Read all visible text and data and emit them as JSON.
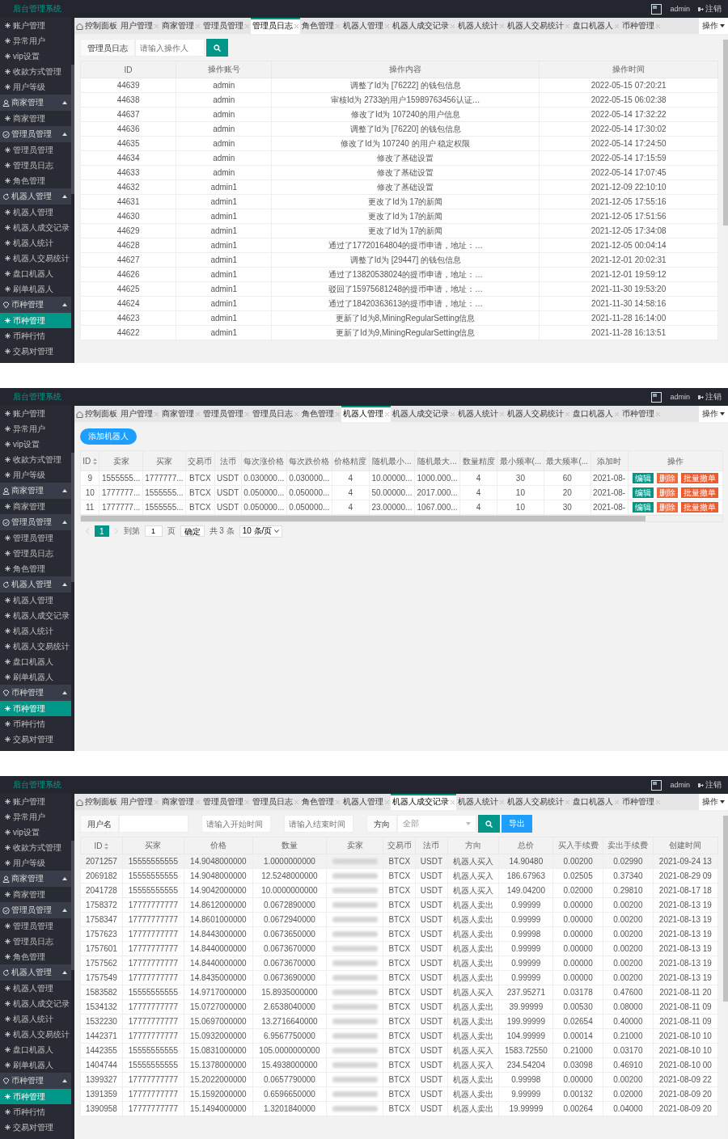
{
  "screens": [
    {
      "brand": "后台管理系统",
      "user": "admin",
      "logout": "注销",
      "sidebar": {
        "items": [
          {
            "label": "账户管理",
            "selected": false
          },
          {
            "label": "异常用户",
            "selected": false
          },
          {
            "label": "vip设置",
            "selected": false
          },
          {
            "label": "收款方式管理",
            "selected": false
          },
          {
            "label": "用户等级",
            "selected": false
          }
        ],
        "groups": [
          {
            "kind": "user",
            "label": "商家管理",
            "expanded": true,
            "items": [
              {
                "label": "商家管理",
                "selected": false
              }
            ]
          },
          {
            "kind": "shield",
            "label": "管理员管理",
            "expanded": true,
            "items": [
              {
                "label": "管理员管理",
                "selected": false
              },
              {
                "label": "管理员日志",
                "selected": false
              },
              {
                "label": "角色管理",
                "selected": false
              }
            ]
          },
          {
            "kind": "robot",
            "label": "机器人管理",
            "expanded": true,
            "items": [
              {
                "label": "机器人管理",
                "selected": false
              },
              {
                "label": "机器人成交记录",
                "selected": false
              },
              {
                "label": "机器人统计",
                "selected": false
              },
              {
                "label": "机器人交易统计",
                "selected": false
              },
              {
                "label": "盘口机器人",
                "selected": false
              },
              {
                "label": "刷单机器人",
                "selected": false
              }
            ]
          },
          {
            "kind": "coin",
            "label": "币种管理",
            "expanded": true,
            "items": [
              {
                "label": "币种管理",
                "selected": true
              },
              {
                "label": "币种行情",
                "selected": false
              },
              {
                "label": "交易对管理",
                "selected": false
              }
            ]
          }
        ]
      },
      "tabs": [
        {
          "kind": "home",
          "label": "控制面板",
          "selected": false
        },
        {
          "kind": "page",
          "label": "用户管理",
          "selected": false
        },
        {
          "kind": "page",
          "label": "商家管理",
          "selected": false
        },
        {
          "kind": "page",
          "label": "管理员管理",
          "selected": false
        },
        {
          "kind": "page",
          "label": "管理员日志",
          "selected": true
        },
        {
          "kind": "page",
          "label": "角色管理",
          "selected": false
        },
        {
          "kind": "page",
          "label": "机器人管理",
          "selected": false
        },
        {
          "kind": "page",
          "label": "机器人成交记录",
          "selected": false
        },
        {
          "kind": "page",
          "label": "机器人统计",
          "selected": false
        },
        {
          "kind": "page",
          "label": "机器人交易统计",
          "selected": false
        },
        {
          "kind": "page",
          "label": "盘口机器人",
          "selected": false
        },
        {
          "kind": "page",
          "label": "币种管理",
          "selected": false
        }
      ],
      "tab_menu": "操作",
      "content": {
        "kind": "log",
        "search": {
          "label": "管理员日志",
          "placeholder": "请输入操作人"
        },
        "columns": [
          {
            "label": "ID",
            "sortable": false
          },
          {
            "label": "操作账号",
            "sortable": false
          },
          {
            "label": "操作内容",
            "sortable": false
          },
          {
            "label": "操作时间",
            "sortable": false
          }
        ],
        "rows": [
          [
            "44639",
            "admin",
            "调整了Id为 [76222] 的钱包信息",
            "2022-05-15 07:20:21"
          ],
          [
            "44638",
            "admin",
            "审核Id为 2733的用户15989763456认证…",
            "2022-05-15 06:02:38"
          ],
          [
            "44637",
            "admin",
            "修改了Id为 107240的用户信息",
            "2022-05-14 17:32:22"
          ],
          [
            "44636",
            "admin",
            "调整了Id为 [76220] 的钱包信息",
            "2022-05-14 17:30:02"
          ],
          [
            "44635",
            "admin",
            "修改了Id为 107240 的用户 稳定权限",
            "2022-05-14 17:24:50"
          ],
          [
            "44634",
            "admin",
            "修改了基础设置",
            "2022-05-14 17:15:59"
          ],
          [
            "44633",
            "admin",
            "修改了基础设置",
            "2022-05-14 17:07:45"
          ],
          [
            "44632",
            "admin1",
            "修改了基础设置",
            "2021-12-09 22:10:10"
          ],
          [
            "44631",
            "admin1",
            "更改了Id为 17的新闻",
            "2021-12-05 17:55:16"
          ],
          [
            "44630",
            "admin1",
            "更改了Id为 17的新闻",
            "2021-12-05 17:51:56"
          ],
          [
            "44629",
            "admin1",
            "更改了Id为 17的新闻",
            "2021-12-05 17:34:08"
          ],
          [
            "44628",
            "admin1",
            "通过了17720164804的提币申请，地址：…",
            "2021-12-05 00:04:14"
          ],
          [
            "44627",
            "admin1",
            "调整了Id为 [29447] 的钱包信息",
            "2021-12-01 20:02:31"
          ],
          [
            "44626",
            "admin1",
            "通过了13820538024的提币申请，地址：…",
            "2021-12-01 19:59:12"
          ],
          [
            "44625",
            "admin1",
            "驳回了15975681248的提币申请，地址：…",
            "2021-11-30 19:53:20"
          ],
          [
            "44624",
            "admin1",
            "通过了18420363613的提币申请，地址：…",
            "2021-11-30 14:58:16"
          ],
          [
            "44623",
            "admin1",
            "更新了Id为8,MiningRegularSetting信息",
            "2021-11-28 16:14:00"
          ],
          [
            "44622",
            "admin1",
            "更新了Id为9,MiningRegularSetting信息",
            "2021-11-28 16:13:51"
          ]
        ]
      }
    },
    {
      "brand": "后台管理系统",
      "user": "admin",
      "logout": "注销",
      "sidebar": {
        "items": [
          {
            "label": "账户管理",
            "selected": false
          },
          {
            "label": "异常用户",
            "selected": false
          },
          {
            "label": "vip设置",
            "selected": false
          },
          {
            "label": "收款方式管理",
            "selected": false
          },
          {
            "label": "用户等级",
            "selected": false
          }
        ],
        "groups": [
          {
            "kind": "user",
            "label": "商家管理",
            "expanded": true,
            "items": [
              {
                "label": "商家管理",
                "selected": false
              }
            ]
          },
          {
            "kind": "shield",
            "label": "管理员管理",
            "expanded": true,
            "items": [
              {
                "label": "管理员管理",
                "selected": false
              },
              {
                "label": "管理员日志",
                "selected": false
              },
              {
                "label": "角色管理",
                "selected": false
              }
            ]
          },
          {
            "kind": "robot",
            "label": "机器人管理",
            "expanded": true,
            "items": [
              {
                "label": "机器人管理",
                "selected": false
              },
              {
                "label": "机器人成交记录",
                "selected": false
              },
              {
                "label": "机器人统计",
                "selected": false
              },
              {
                "label": "机器人交易统计",
                "selected": false
              },
              {
                "label": "盘口机器人",
                "selected": false
              },
              {
                "label": "刷单机器人",
                "selected": false
              }
            ]
          },
          {
            "kind": "coin",
            "label": "币种管理",
            "expanded": true,
            "items": [
              {
                "label": "币种管理",
                "selected": true
              },
              {
                "label": "币种行情",
                "selected": false
              },
              {
                "label": "交易对管理",
                "selected": false
              }
            ]
          }
        ]
      },
      "tabs": [
        {
          "kind": "home",
          "label": "控制面板",
          "selected": false
        },
        {
          "kind": "page",
          "label": "用户管理",
          "selected": false
        },
        {
          "kind": "page",
          "label": "商家管理",
          "selected": false
        },
        {
          "kind": "page",
          "label": "管理员管理",
          "selected": false
        },
        {
          "kind": "page",
          "label": "管理员日志",
          "selected": false
        },
        {
          "kind": "page",
          "label": "角色管理",
          "selected": false
        },
        {
          "kind": "page",
          "label": "机器人管理",
          "selected": true
        },
        {
          "kind": "page",
          "label": "机器人成交记录",
          "selected": false
        },
        {
          "kind": "page",
          "label": "机器人统计",
          "selected": false
        },
        {
          "kind": "page",
          "label": "机器人交易统计",
          "selected": false
        },
        {
          "kind": "page",
          "label": "盘口机器人",
          "selected": false
        },
        {
          "kind": "page",
          "label": "币种管理",
          "selected": false
        }
      ],
      "tab_menu": "操作",
      "content": {
        "kind": "robots",
        "add_button": "添加机器人",
        "columns": [
          {
            "label": "ID",
            "sortable": true
          },
          {
            "label": "卖家",
            "sortable": false
          },
          {
            "label": "买家",
            "sortable": false
          },
          {
            "label": "交易币",
            "sortable": false
          },
          {
            "label": "法币",
            "sortable": false
          },
          {
            "label": "每次涨价格",
            "sortable": false
          },
          {
            "label": "每次跌价格",
            "sortable": false
          },
          {
            "label": "价格精度",
            "sortable": false
          },
          {
            "label": "随机最小...",
            "sortable": false
          },
          {
            "label": "随机最大...",
            "sortable": false
          },
          {
            "label": "数量精度",
            "sortable": false
          },
          {
            "label": "最小频率(...",
            "sortable": false
          },
          {
            "label": "最大频率(...",
            "sortable": false
          },
          {
            "label": "添加时",
            "sortable": false
          },
          {
            "label": "操作",
            "sortable": false
          }
        ],
        "rows": [
          {
            "cells": [
              "9",
              "1555555...",
              "1777777...",
              "BTCX",
              "USDT",
              "0.030000...",
              "0.030000...",
              "4",
              "10.00000...",
              "1000.000...",
              "4",
              "30",
              "60",
              "2021-08-"
            ],
            "actions": [
              {
                "label": "编辑",
                "color": "#009688"
              },
              {
                "label": "删除",
                "color": "#f0683c"
              },
              {
                "label": "批量撤单",
                "color": "#ec5a2e"
              }
            ]
          },
          {
            "cells": [
              "10",
              "1777777...",
              "1555555...",
              "BTCX",
              "USDT",
              "0.050000...",
              "0.050000...",
              "4",
              "50.00000...",
              "2017.000...",
              "4",
              "10",
              "20",
              "2021-08-"
            ],
            "actions": [
              {
                "label": "编辑",
                "color": "#009688"
              },
              {
                "label": "删除",
                "color": "#f0683c"
              },
              {
                "label": "批量撤单",
                "color": "#ec5a2e"
              }
            ]
          },
          {
            "cells": [
              "11",
              "1777777...",
              "1555555...",
              "BTCX",
              "USDT",
              "0.050000...",
              "0.050000...",
              "4",
              "23.00000...",
              "1067.000...",
              "4",
              "10",
              "30",
              "2021-08-"
            ],
            "actions": [
              {
                "label": "编辑",
                "color": "#009688"
              },
              {
                "label": "删除",
                "color": "#f0683c"
              },
              {
                "label": "批量撤单",
                "color": "#ec5a2e"
              }
            ]
          }
        ],
        "pagination": {
          "pages": [
            {
              "label": "1",
              "selected": true
            }
          ],
          "goto_label": "到第",
          "goto_value": "1",
          "page_unit": "页",
          "confirm": "确定",
          "total": "共 3 条",
          "page_size": "10 条/页"
        }
      }
    },
    {
      "brand": "后台管理系统",
      "user": "admin",
      "logout": "注销",
      "sidebar": {
        "items": [
          {
            "label": "账户管理",
            "selected": false
          },
          {
            "label": "异常用户",
            "selected": false
          },
          {
            "label": "vip设置",
            "selected": false
          },
          {
            "label": "收款方式管理",
            "selected": false
          },
          {
            "label": "用户等级",
            "selected": false
          }
        ],
        "groups": [
          {
            "kind": "user",
            "label": "商家管理",
            "expanded": true,
            "items": [
              {
                "label": "商家管理",
                "selected": false
              }
            ]
          },
          {
            "kind": "shield",
            "label": "管理员管理",
            "expanded": true,
            "items": [
              {
                "label": "管理员管理",
                "selected": false
              },
              {
                "label": "管理员日志",
                "selected": false
              },
              {
                "label": "角色管理",
                "selected": false
              }
            ]
          },
          {
            "kind": "robot",
            "label": "机器人管理",
            "expanded": true,
            "items": [
              {
                "label": "机器人管理",
                "selected": false
              },
              {
                "label": "机器人成交记录",
                "selected": false
              },
              {
                "label": "机器人统计",
                "selected": false
              },
              {
                "label": "机器人交易统计",
                "selected": false
              },
              {
                "label": "盘口机器人",
                "selected": false
              },
              {
                "label": "刷单机器人",
                "selected": false
              }
            ]
          },
          {
            "kind": "coin",
            "label": "币种管理",
            "expanded": true,
            "items": [
              {
                "label": "币种管理",
                "selected": true
              },
              {
                "label": "币种行情",
                "selected": false
              },
              {
                "label": "交易对管理",
                "selected": false
              }
            ]
          }
        ]
      },
      "tabs": [
        {
          "kind": "home",
          "label": "控制面板",
          "selected": false
        },
        {
          "kind": "page",
          "label": "用户管理",
          "selected": false
        },
        {
          "kind": "page",
          "label": "商家管理",
          "selected": false
        },
        {
          "kind": "page",
          "label": "管理员管理",
          "selected": false
        },
        {
          "kind": "page",
          "label": "管理员日志",
          "selected": false
        },
        {
          "kind": "page",
          "label": "角色管理",
          "selected": false
        },
        {
          "kind": "page",
          "label": "机器人管理",
          "selected": false
        },
        {
          "kind": "page",
          "label": "机器人成交记录",
          "selected": true
        },
        {
          "kind": "page",
          "label": "机器人统计",
          "selected": false
        },
        {
          "kind": "page",
          "label": "机器人交易统计",
          "selected": false
        },
        {
          "kind": "page",
          "label": "盘口机器人",
          "selected": false
        },
        {
          "kind": "page",
          "label": "币种管理",
          "selected": false
        }
      ],
      "tab_menu": "操作",
      "content": {
        "kind": "trades",
        "filters": {
          "username_label": "用户名",
          "start_placeholder": "请输入开始时间",
          "end_placeholder": "请输入结束时间",
          "direction_label": "方向",
          "direction_value": "全部",
          "export": "导出"
        },
        "columns": [
          {
            "label": "ID",
            "sortable": true,
            "redacted": false
          },
          {
            "label": "买家",
            "sortable": false,
            "redacted": false
          },
          {
            "label": "价格",
            "sortable": false,
            "redacted": false
          },
          {
            "label": "数量",
            "sortable": false,
            "redacted": false
          },
          {
            "label": "卖家",
            "sortable": false,
            "redacted": true
          },
          {
            "label": "交易币",
            "sortable": false,
            "redacted": false
          },
          {
            "label": "法币",
            "sortable": false,
            "redacted": false
          },
          {
            "label": "方向",
            "sortable": false,
            "redacted": false
          },
          {
            "label": "总价",
            "sortable": false,
            "redacted": false
          },
          {
            "label": "买入手续费",
            "sortable": false,
            "redacted": false
          },
          {
            "label": "卖出手续费",
            "sortable": false,
            "redacted": false
          },
          {
            "label": "创建时间",
            "sortable": false,
            "redacted": false
          }
        ],
        "rows": [
          {
            "hover": true,
            "cells": [
              "2071257",
              "15555555555",
              "14.9048000000",
              "1.0000000000",
              "",
              "BTCX",
              "USDT",
              "机器人买入",
              "14.90480",
              "0.00200",
              "0.02990",
              "2021-09-24 13"
            ]
          },
          {
            "hover": false,
            "cells": [
              "2069182",
              "15555555555",
              "14.9048000000",
              "12.5248000000",
              "",
              "BTCX",
              "USDT",
              "机器人买入",
              "186.67963",
              "0.02505",
              "0.37340",
              "2021-08-29 09"
            ]
          },
          {
            "hover": false,
            "cells": [
              "2041728",
              "15555555555",
              "14.9042000000",
              "10.0000000000",
              "",
              "BTCX",
              "USDT",
              "机器人买入",
              "149.04200",
              "0.02000",
              "0.29810",
              "2021-08-17 18"
            ]
          },
          {
            "hover": false,
            "cells": [
              "1758372",
              "17777777777",
              "14.8612000000",
              "0.0672890000",
              "",
              "BTCX",
              "USDT",
              "机器人卖出",
              "0.99999",
              "0.00000",
              "0.00200",
              "2021-08-13 19"
            ]
          },
          {
            "hover": false,
            "cells": [
              "1758347",
              "17777777777",
              "14.8601000000",
              "0.0672940000",
              "",
              "BTCX",
              "USDT",
              "机器人卖出",
              "0.99999",
              "0.00000",
              "0.00200",
              "2021-08-13 19"
            ]
          },
          {
            "hover": false,
            "cells": [
              "1757623",
              "17777777777",
              "14.8443000000",
              "0.0673650000",
              "",
              "BTCX",
              "USDT",
              "机器人卖出",
              "0.99998",
              "0.00000",
              "0.00200",
              "2021-08-13 19"
            ]
          },
          {
            "hover": false,
            "cells": [
              "1757601",
              "17777777777",
              "14.8440000000",
              "0.0673670000",
              "",
              "BTCX",
              "USDT",
              "机器人卖出",
              "0.99999",
              "0.00000",
              "0.00200",
              "2021-08-13 19"
            ]
          },
          {
            "hover": false,
            "cells": [
              "1757562",
              "17777777777",
              "14.8440000000",
              "0.0673670000",
              "",
              "BTCX",
              "USDT",
              "机器人卖出",
              "0.99999",
              "0.00000",
              "0.00200",
              "2021-08-13 19"
            ]
          },
          {
            "hover": false,
            "cells": [
              "1757549",
              "17777777777",
              "14.8435000000",
              "0.0673690000",
              "",
              "BTCX",
              "USDT",
              "机器人卖出",
              "0.99999",
              "0.00000",
              "0.00200",
              "2021-08-13 19"
            ]
          },
          {
            "hover": false,
            "cells": [
              "1583582",
              "15555555555",
              "14.9717000000",
              "15.8935000000",
              "",
              "BTCX",
              "USDT",
              "机器人买入",
              "237.95271",
              "0.03178",
              "0.47600",
              "2021-08-11 20"
            ]
          },
          {
            "hover": false,
            "cells": [
              "1534132",
              "17777777777",
              "15.0727000000",
              "2.6538040000",
              "",
              "BTCX",
              "USDT",
              "机器人卖出",
              "39.99999",
              "0.00530",
              "0.08000",
              "2021-08-11 09"
            ]
          },
          {
            "hover": false,
            "cells": [
              "1532230",
              "17777777777",
              "15.0697000000",
              "13.2716640000",
              "",
              "BTCX",
              "USDT",
              "机器人卖出",
              "199.99999",
              "0.02654",
              "0.40000",
              "2021-08-11 09"
            ]
          },
          {
            "hover": false,
            "cells": [
              "1442371",
              "17777777777",
              "15.0932000000",
              "6.9567750000",
              "",
              "BTCX",
              "USDT",
              "机器人卖出",
              "104.99999",
              "0.00014",
              "0.21000",
              "2021-08-10 10"
            ]
          },
          {
            "hover": false,
            "cells": [
              "1442355",
              "15555555555",
              "15.0831000000",
              "105.0000000000",
              "",
              "BTCX",
              "USDT",
              "机器人买入",
              "1583.72550",
              "0.21000",
              "0.03170",
              "2021-08-10 10"
            ]
          },
          {
            "hover": false,
            "cells": [
              "1404744",
              "15555555555",
              "15.1378000000",
              "15.4938000000",
              "",
              "BTCX",
              "USDT",
              "机器人买入",
              "234.54204",
              "0.03098",
              "0.46910",
              "2021-08-10 00"
            ]
          },
          {
            "hover": false,
            "cells": [
              "1399327",
              "17777777777",
              "15.2022000000",
              "0.0657790000",
              "",
              "BTCX",
              "USDT",
              "机器人卖出",
              "0.99998",
              "0.00000",
              "0.00200",
              "2021-08-09 22"
            ]
          },
          {
            "hover": false,
            "cells": [
              "1391359",
              "17777777777",
              "15.1592000000",
              "0.6596650000",
              "",
              "BTCX",
              "USDT",
              "机器人卖出",
              "9.99999",
              "0.00132",
              "0.02000",
              "2021-08-09 20"
            ]
          },
          {
            "hover": false,
            "cells": [
              "1390958",
              "17777777777",
              "15.1494000000",
              "1.3201840000",
              "",
              "BTCX",
              "USDT",
              "机器人卖出",
              "19.99999",
              "0.00264",
              "0.04000",
              "2021-08-09 20"
            ]
          }
        ]
      }
    }
  ]
}
